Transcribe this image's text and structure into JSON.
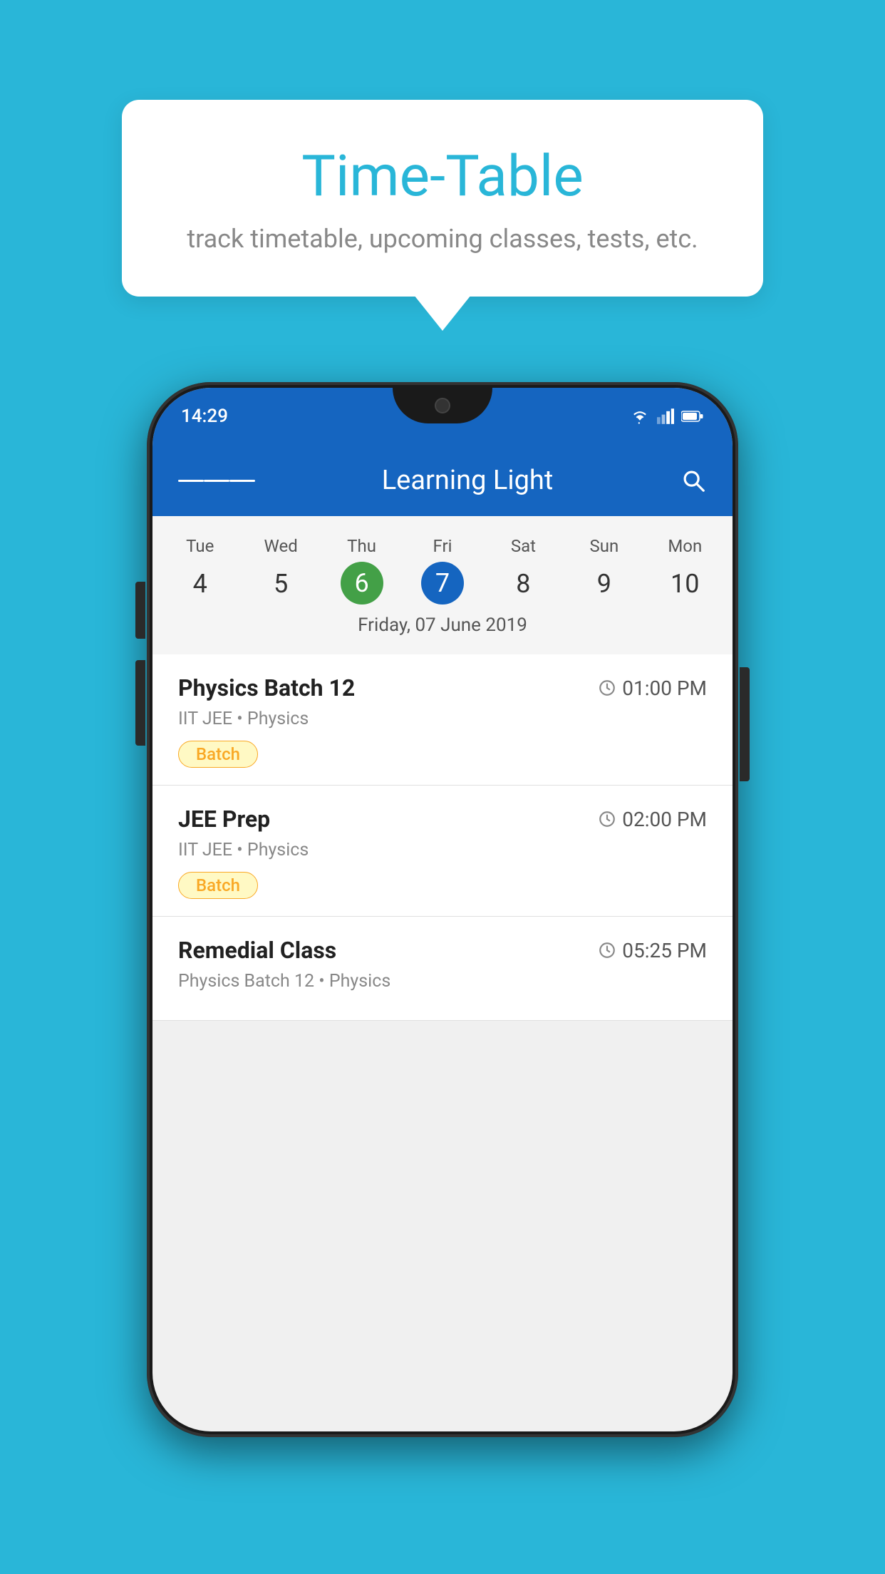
{
  "page": {
    "bg_color": "#29B6D8"
  },
  "tooltip": {
    "title": "Time-Table",
    "subtitle": "track timetable, upcoming classes, tests, etc."
  },
  "phone": {
    "status_bar": {
      "time": "14:29"
    },
    "app_bar": {
      "title": "Learning Light",
      "menu_label": "menu",
      "search_label": "search"
    },
    "calendar": {
      "days": [
        "Tue",
        "Wed",
        "Thu",
        "Fri",
        "Sat",
        "Sun",
        "Mon"
      ],
      "dates": [
        "4",
        "5",
        "6",
        "7",
        "8",
        "9",
        "10"
      ],
      "today_index": 2,
      "selected_index": 3,
      "selected_date_label": "Friday, 07 June 2019"
    },
    "classes": [
      {
        "name": "Physics Batch 12",
        "time": "01:00 PM",
        "meta": "IIT JEE • Physics",
        "badge": "Batch"
      },
      {
        "name": "JEE Prep",
        "time": "02:00 PM",
        "meta": "IIT JEE • Physics",
        "badge": "Batch"
      },
      {
        "name": "Remedial Class",
        "time": "05:25 PM",
        "meta": "Physics Batch 12 • Physics",
        "badge": ""
      }
    ]
  }
}
